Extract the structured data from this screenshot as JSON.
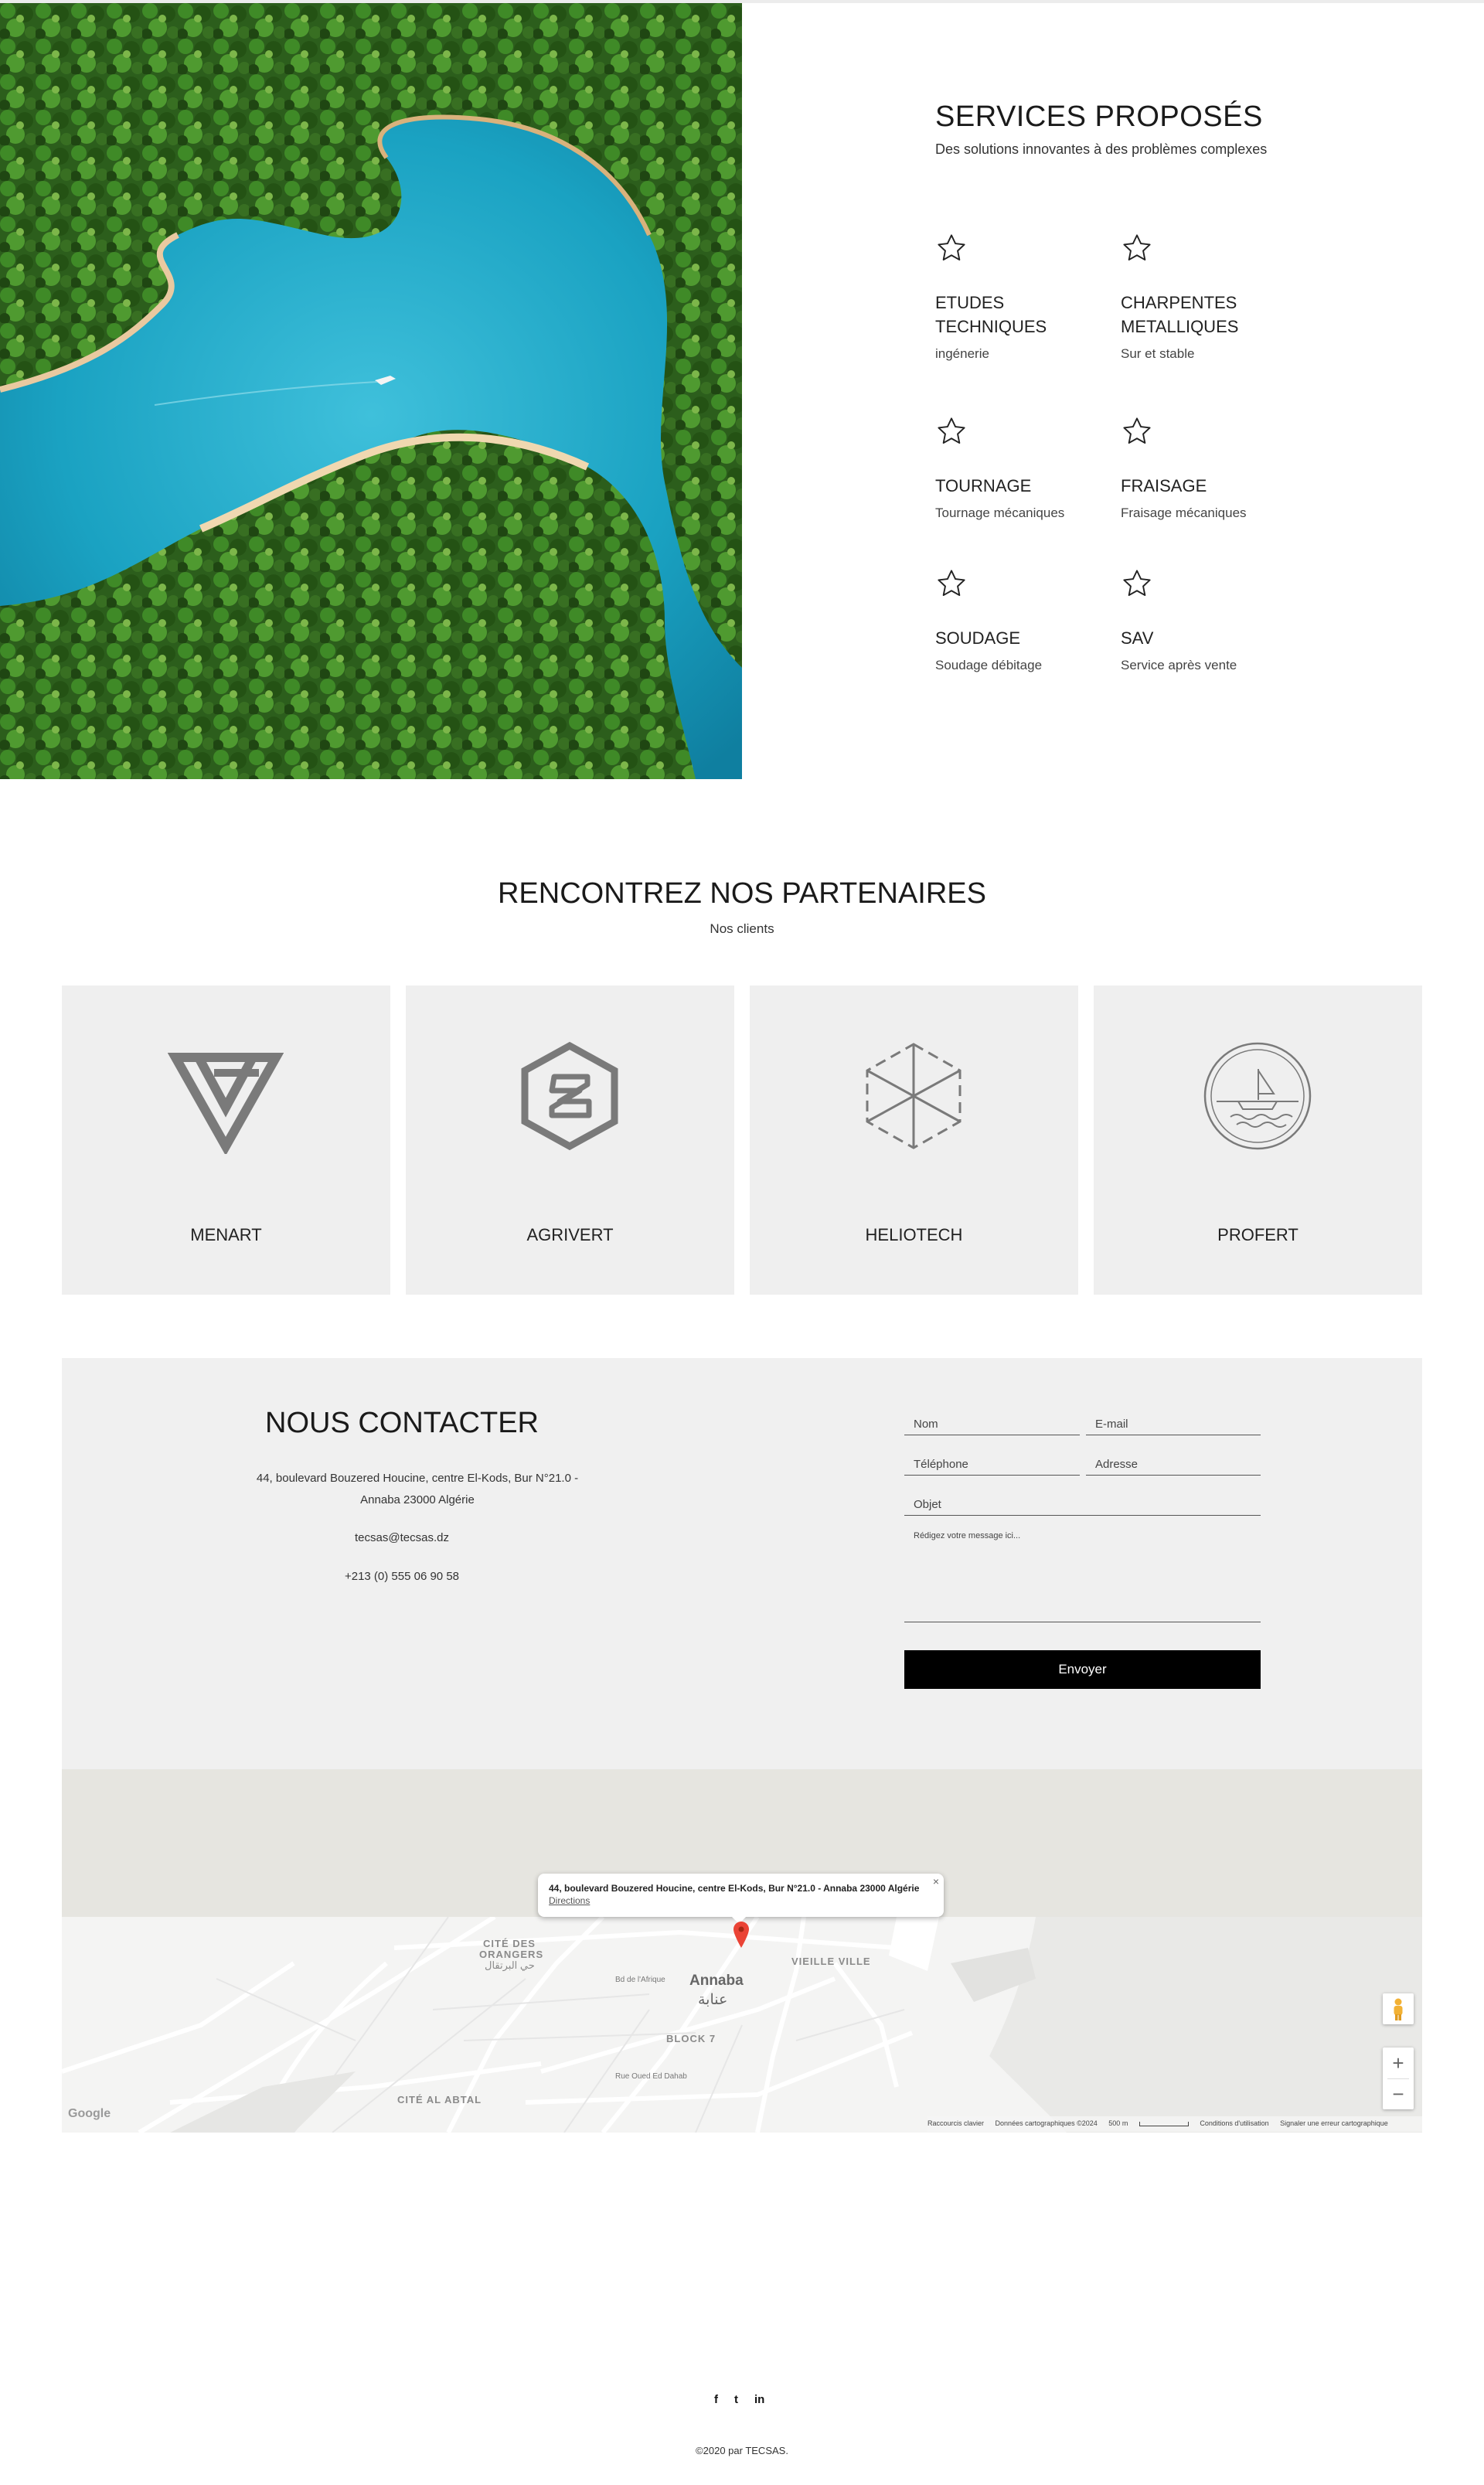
{
  "services": {
    "title": "SERVICES PROPOSÉS",
    "subtitle": "Des solutions innovantes à des problèmes complexes",
    "items": [
      {
        "title": "ETUDES TECHNIQUES",
        "desc": "ingénerie",
        "icon": "star-icon"
      },
      {
        "title": "CHARPENTES METALLIQUES",
        "desc": "Sur et stable",
        "icon": "star-icon"
      },
      {
        "title": "TOURNAGE",
        "desc": "Tournage mécaniques",
        "icon": "star-icon"
      },
      {
        "title": "FRAISAGE",
        "desc": "Fraisage mécaniques",
        "icon": "star-icon"
      },
      {
        "title": "SOUDAGE",
        "desc": "Soudage débitage",
        "icon": "star-icon"
      },
      {
        "title": "SAV",
        "desc": "Service après vente",
        "icon": "star-icon"
      }
    ]
  },
  "partners": {
    "title": "RENCONTREZ NOS PARTENAIRES",
    "subtitle": "Nos clients",
    "items": [
      {
        "name": "MENART",
        "logo": "triangle-logo"
      },
      {
        "name": "AGRIVERT",
        "logo": "hexagon-s-logo"
      },
      {
        "name": "HELIOTECH",
        "logo": "cube-logo"
      },
      {
        "name": "PROFERT",
        "logo": "boat-circle-logo"
      }
    ]
  },
  "contact": {
    "title": "NOUS CONTACTER",
    "address_line1": "44, boulevard Bouzered Houcine, centre El-Kods, Bur N°21.0 -",
    "address_line2": "Annaba 23000 Algérie",
    "email": "tecsas@tecsas.dz",
    "phone": "+213 (0) 555 06 90 58",
    "form": {
      "name_placeholder": "Nom",
      "email_placeholder": "E-mail",
      "phone_placeholder": "Téléphone",
      "address_placeholder": "Adresse",
      "subject_placeholder": "Objet",
      "message_placeholder": "Rédigez votre message ici...",
      "submit_label": "Envoyer"
    }
  },
  "map": {
    "popup_address": "44, boulevard Bouzered Houcine, centre El-Kods, Bur N°21.0 - Annaba 23000 Algérie",
    "popup_link": "Directions",
    "popup_close": "×",
    "labels": {
      "cite_des_orangers_1": "CITÉ DES",
      "cite_des_orangers_2": "ORANGERS",
      "cite_des_orangers_ar": "حي البرتقال",
      "vieille_ville": "VIEILLE VILLE",
      "city": "Annaba",
      "city_ar": "عنابة",
      "block7": "BLOCK 7",
      "cite_al_abtal": "CITÉ AL ABTAL",
      "street_afrique": "Bd de l'Afrique",
      "street_ouled": "Rue Oued Ed Dahab"
    },
    "zoom_in": "+",
    "zoom_out": "−",
    "google": "Google",
    "attribution": {
      "shortcuts": "Raccourcis clavier",
      "data": "Données cartographiques ©2024",
      "scale": "500 m",
      "terms": "Conditions d'utilisation",
      "report": "Signaler une erreur cartographique"
    }
  },
  "footer": {
    "social": [
      {
        "label": "f",
        "icon": "facebook-icon"
      },
      {
        "label": "t",
        "icon": "twitter-icon"
      },
      {
        "label": "in",
        "icon": "linkedin-icon"
      }
    ],
    "copyright": "©2020 par TECSAS."
  },
  "colors": {
    "accent": "#000000",
    "panel": "#efefef",
    "water": "#1fa4c4",
    "forest": "#2f6a1f"
  }
}
